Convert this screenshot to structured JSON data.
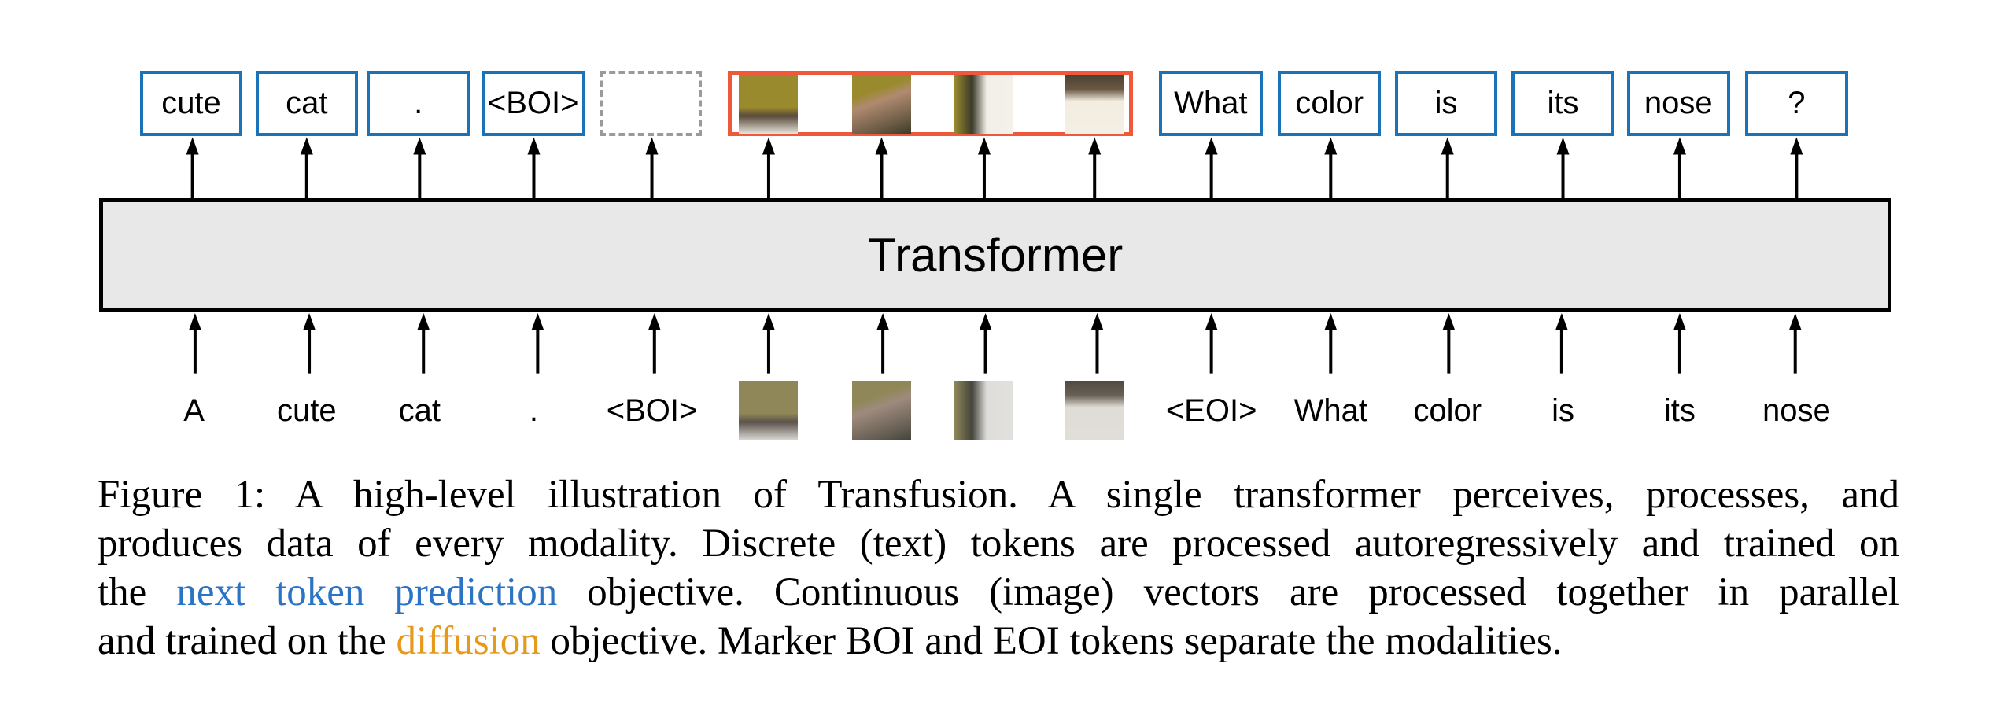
{
  "figure": {
    "transformer_label": "Transformer",
    "output_tokens": [
      {
        "type": "text",
        "label": "cute"
      },
      {
        "type": "text",
        "label": "cat"
      },
      {
        "type": "text",
        "label": "."
      },
      {
        "type": "text",
        "label": "<BOI>"
      },
      {
        "type": "empty",
        "label": ""
      },
      {
        "type": "image",
        "label": "clean image patch 1"
      },
      {
        "type": "image",
        "label": "clean image patch 2"
      },
      {
        "type": "image",
        "label": "clean image patch 3"
      },
      {
        "type": "image",
        "label": "clean image patch 4"
      },
      {
        "type": "text",
        "label": "What"
      },
      {
        "type": "text",
        "label": "color"
      },
      {
        "type": "text",
        "label": "is"
      },
      {
        "type": "text",
        "label": "its"
      },
      {
        "type": "text",
        "label": "nose"
      },
      {
        "type": "text",
        "label": "?"
      }
    ],
    "input_tokens": [
      {
        "type": "text",
        "label": "A"
      },
      {
        "type": "text",
        "label": "cute"
      },
      {
        "type": "text",
        "label": "cat"
      },
      {
        "type": "text",
        "label": "."
      },
      {
        "type": "text",
        "label": "<BOI>"
      },
      {
        "type": "image",
        "label": "noisy image patch 1"
      },
      {
        "type": "image",
        "label": "noisy image patch 2"
      },
      {
        "type": "image",
        "label": "noisy image patch 3"
      },
      {
        "type": "image",
        "label": "noisy image patch 4"
      },
      {
        "type": "text",
        "label": "<EOI>"
      },
      {
        "type": "text",
        "label": "What"
      },
      {
        "type": "text",
        "label": "color"
      },
      {
        "type": "text",
        "label": "is"
      },
      {
        "type": "text",
        "label": "its"
      },
      {
        "type": "text",
        "label": "nose"
      }
    ],
    "colors": {
      "text_token_border": "#1a73b8",
      "image_group_border": "#f0583c",
      "empty_token_border": "#9a9a9a",
      "transformer_fill": "#e8e8e8",
      "next_token_prediction": "#2b73c4",
      "diffusion": "#e59a1c"
    }
  },
  "caption": {
    "lines": [
      [
        {
          "text": "Figure 1: A high-level illustration of Transfusion.  A single transformer perceives, processes, and"
        }
      ],
      [
        {
          "text": "produces data of every modality. Discrete (text) tokens are processed autoregressively and trained on"
        }
      ],
      [
        {
          "text": "the "
        },
        {
          "text": "next token prediction",
          "color": "#2b73c4"
        },
        {
          "text": " objective. Continuous (image) vectors are processed together in parallel"
        }
      ],
      [
        {
          "text": "and trained on the "
        },
        {
          "text": "diffusion",
          "color": "#e59a1c"
        },
        {
          "text": " objective. Marker BOI and EOI tokens separate the modalities."
        }
      ]
    ]
  }
}
